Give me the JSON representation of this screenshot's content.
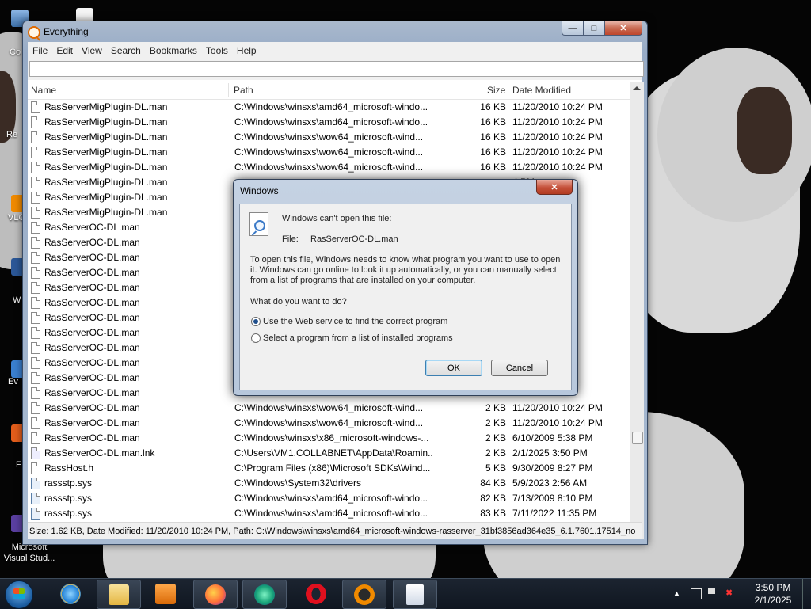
{
  "desktop": {
    "icons": [
      {
        "label": "Co"
      },
      {
        "label": "Re"
      },
      {
        "label": "VLC"
      },
      {
        "label": "W"
      },
      {
        "label": "Ev"
      },
      {
        "label": "F"
      },
      {
        "label": "Microsoft Visual Stud..."
      }
    ]
  },
  "window": {
    "title": "Everything",
    "menu": [
      "File",
      "Edit",
      "View",
      "Search",
      "Bookmarks",
      "Tools",
      "Help"
    ],
    "search_value": "",
    "columns": {
      "name": "Name",
      "path": "Path",
      "size": "Size",
      "date": "Date Modified"
    },
    "rows": [
      {
        "name": "RasServerMigPlugin-DL.man",
        "path": "C:\\Windows\\winsxs\\amd64_microsoft-windo...",
        "size": "16 KB",
        "date": "11/20/2010 10:24 PM",
        "icon": "file-icon"
      },
      {
        "name": "RasServerMigPlugin-DL.man",
        "path": "C:\\Windows\\winsxs\\amd64_microsoft-windo...",
        "size": "16 KB",
        "date": "11/20/2010 10:24 PM",
        "icon": "file-icon"
      },
      {
        "name": "RasServerMigPlugin-DL.man",
        "path": "C:\\Windows\\winsxs\\wow64_microsoft-wind...",
        "size": "16 KB",
        "date": "11/20/2010 10:24 PM",
        "icon": "file-icon"
      },
      {
        "name": "RasServerMigPlugin-DL.man",
        "path": "C:\\Windows\\winsxs\\wow64_microsoft-wind...",
        "size": "16 KB",
        "date": "11/20/2010 10:24 PM",
        "icon": "file-icon"
      },
      {
        "name": "RasServerMigPlugin-DL.man",
        "path": "C:\\Windows\\winsxs\\wow64_microsoft-wind...",
        "size": "16 KB",
        "date": "11/20/2010 10:24 PM",
        "icon": "file-icon"
      },
      {
        "name": "RasServerMigPlugin-DL.man",
        "path": "",
        "size": "",
        "date": "4 PM",
        "icon": "file-icon"
      },
      {
        "name": "RasServerMigPlugin-DL.man",
        "path": "",
        "size": "",
        "date": "4 PM",
        "icon": "file-icon"
      },
      {
        "name": "RasServerMigPlugin-DL.man",
        "path": "",
        "size": "",
        "date": "PM",
        "icon": "file-icon"
      },
      {
        "name": "RasServerOC-DL.man",
        "path": "",
        "size": "",
        "date": "4 PM",
        "icon": "file-icon"
      },
      {
        "name": "RasServerOC-DL.man",
        "path": "",
        "size": "",
        "date": "PM",
        "icon": "file-icon"
      },
      {
        "name": "RasServerOC-DL.man",
        "path": "",
        "size": "",
        "date": "4 PM",
        "icon": "file-icon"
      },
      {
        "name": "RasServerOC-DL.man",
        "path": "",
        "size": "",
        "date": "PM",
        "icon": "file-icon"
      },
      {
        "name": "RasServerOC-DL.man",
        "path": "",
        "size": "",
        "date": "PM",
        "icon": "file-icon"
      },
      {
        "name": "RasServerOC-DL.man",
        "path": "",
        "size": "",
        "date": "4 PM",
        "icon": "file-icon"
      },
      {
        "name": "RasServerOC-DL.man",
        "path": "",
        "size": "",
        "date": "4 PM",
        "icon": "file-icon"
      },
      {
        "name": "RasServerOC-DL.man",
        "path": "",
        "size": "",
        "date": "4 PM",
        "icon": "file-icon"
      },
      {
        "name": "RasServerOC-DL.man",
        "path": "",
        "size": "",
        "date": "4 PM",
        "icon": "file-icon"
      },
      {
        "name": "RasServerOC-DL.man",
        "path": "",
        "size": "",
        "date": "4 PM",
        "icon": "file-icon"
      },
      {
        "name": "RasServerOC-DL.man",
        "path": "",
        "size": "",
        "date": "4 PM",
        "icon": "file-icon"
      },
      {
        "name": "RasServerOC-DL.man",
        "path": "",
        "size": "",
        "date": "4 PM",
        "icon": "file-icon"
      },
      {
        "name": "RasServerOC-DL.man",
        "path": "C:\\Windows\\winsxs\\wow64_microsoft-wind...",
        "size": "2 KB",
        "date": "11/20/2010 10:24 PM",
        "icon": "file-icon"
      },
      {
        "name": "RasServerOC-DL.man",
        "path": "C:\\Windows\\winsxs\\wow64_microsoft-wind...",
        "size": "2 KB",
        "date": "11/20/2010 10:24 PM",
        "icon": "file-icon"
      },
      {
        "name": "RasServerOC-DL.man",
        "path": "C:\\Windows\\winsxs\\x86_microsoft-windows-...",
        "size": "2 KB",
        "date": "6/10/2009 5:38 PM",
        "icon": "file-icon"
      },
      {
        "name": "RasServerOC-DL.man.lnk",
        "path": "C:\\Users\\VM1.COLLABNET\\AppData\\Roamin...",
        "size": "2 KB",
        "date": "2/1/2025 3:50 PM",
        "icon": "shortcut-icon"
      },
      {
        "name": "RassHost.h",
        "path": "C:\\Program Files (x86)\\Microsoft SDKs\\Wind...",
        "size": "5 KB",
        "date": "9/30/2009 8:27 PM",
        "icon": "file-icon"
      },
      {
        "name": "rassstp.sys",
        "path": "C:\\Windows\\System32\\drivers",
        "size": "84 KB",
        "date": "5/9/2023 2:56 AM",
        "icon": "system-file-icon"
      },
      {
        "name": "rassstp.sys",
        "path": "C:\\Windows\\winsxs\\amd64_microsoft-windo...",
        "size": "82 KB",
        "date": "7/13/2009 8:10 PM",
        "icon": "system-file-icon"
      },
      {
        "name": "rassstp.sys",
        "path": "C:\\Windows\\winsxs\\amd64_microsoft-windo...",
        "size": "83 KB",
        "date": "7/11/2022 11:35 PM",
        "icon": "system-file-icon"
      }
    ],
    "status": "Size: 1.62 KB, Date Modified: 11/20/2010 10:24 PM, Path: C:\\Windows\\winsxs\\amd64_microsoft-windows-rasserver_31bf3856ad364e35_6.1.7601.17514_no"
  },
  "dialog": {
    "title": "Windows",
    "heading": "Windows can't open this file:",
    "file_label": "File:",
    "file_name": "RasServerOC-DL.man",
    "explanation": "To open this file, Windows needs to know what program you want to use to open it. Windows can go online to look it up automatically, or you can manually select from a list of programs that are installed on your computer.",
    "question": "What do you want to do?",
    "options": [
      {
        "label": "Use the Web service to find the correct program",
        "selected": true
      },
      {
        "label": "Select a program from a list of installed programs",
        "selected": false
      }
    ],
    "ok_label": "OK",
    "cancel_label": "Cancel"
  },
  "taskbar": {
    "pinned": [
      "internet-explorer-icon",
      "file-explorer-icon",
      "media-player-icon",
      "firefox-icon",
      "browser-icon",
      "opera-icon",
      "everything-icon",
      "document-icon"
    ],
    "clock_time": "3:50 PM",
    "clock_date": "2/1/2025"
  },
  "colors": {
    "accent": "#1f4e8c",
    "desktop_bg": "#050505",
    "taskbar": "#1c2430"
  }
}
